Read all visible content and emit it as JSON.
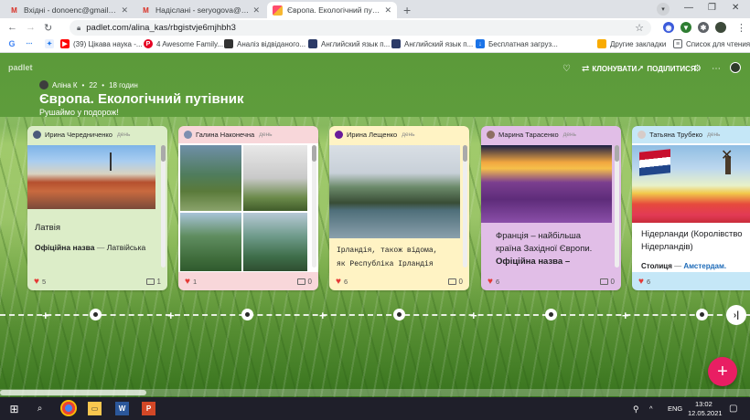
{
  "browser": {
    "tabs": [
      {
        "title": "Вхідні - donoenc@gmail.com - G",
        "favicon": "gmail-icon",
        "active": false
      },
      {
        "title": "Надіслані - seryogova@gmail.cc",
        "favicon": "gmail-icon",
        "active": false
      },
      {
        "title": "Європа. Екологічний путівник",
        "favicon": "padlet-icon",
        "active": true
      }
    ],
    "new_tab": "+",
    "url": "padlet.com/alina_kas/rbgistvje6mjhbh3",
    "window_controls": {
      "minimize": "—",
      "restore": "❐",
      "close": "✕"
    }
  },
  "bookmarks": [
    {
      "label": "(39) Цікава наука -...",
      "icon": "youtube-icon",
      "color": "#ff0000"
    },
    {
      "label": "4 Awesome Family...",
      "icon": "pinterest-icon",
      "color": "#e60023"
    },
    {
      "label": "Аналіз відвіданого...",
      "icon": "doc-icon",
      "color": "#333333"
    },
    {
      "label": "Английский язык п...",
      "icon": "doc-icon",
      "color": "#2b3a67"
    },
    {
      "label": "Английский язык п...",
      "icon": "doc-icon",
      "color": "#2b3a67"
    },
    {
      "label": "Бесплатная загруз...",
      "icon": "download-icon",
      "color": "#1a73e8"
    },
    {
      "label": "Другие закладки",
      "icon": "folder-icon",
      "color": "#f9ab00"
    },
    {
      "label": "Список для чтения",
      "icon": "list-icon",
      "color": "#5f6368"
    }
  ],
  "padlet": {
    "logo": "padlet",
    "author": "Аліна К",
    "likes": "22",
    "time": "18 годин",
    "title": "Європа. Екологічний путівник",
    "subtitle": "Рушаймо у подорож!",
    "actions": {
      "clone": "КЛОНУВАТИ",
      "share": "ПОДІЛИТИСЯ"
    },
    "accent": "#e91e63"
  },
  "cards": [
    {
      "author": "Ирина Чередниченко",
      "ago": "день",
      "title": "Латвія",
      "label": "Офіційна назва",
      "value": "Латвійська",
      "likes": "5",
      "comments": "1"
    },
    {
      "author": "Галина Наконечна",
      "ago": "день",
      "likes": "1",
      "comments": "0"
    },
    {
      "author": "Ирина Лещенко",
      "ago": "день",
      "text_line1": "Ірландія, також відома,",
      "text_line2": "як Республіка Ірландія",
      "likes": "6",
      "comments": "0"
    },
    {
      "author": "Марина Тарасенко",
      "ago": "день",
      "text_line1": "Франція – найбільша",
      "text_line2": "країна Західної Європи.",
      "text_line3": "Офіційна назва –",
      "likes": "6",
      "comments": "0"
    },
    {
      "author": "Татьяна Трубеко",
      "ago": "день",
      "text_line1": "Нідерланди (Королівство",
      "text_line2": "Нідерландів)",
      "label": "Столиця",
      "value": "Амстердам.",
      "likes": "6",
      "comments": ""
    }
  ],
  "taskbar": {
    "lang": "ENG",
    "time": "13:02",
    "date": "12.05.2021"
  }
}
